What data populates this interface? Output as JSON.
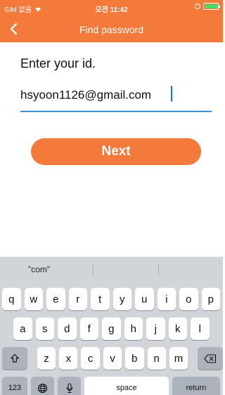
{
  "status_bar": {
    "carrier": "SIM 없음",
    "time": "오전 11:42"
  },
  "nav": {
    "title": "Find password",
    "back_icon": "chevron-left-icon"
  },
  "form": {
    "prompt": "Enter your id.",
    "id_value": "hsyoon1126@gmail.com",
    "next_label": "Next"
  },
  "keyboard": {
    "suggestions": [
      "\"com\"",
      "",
      ""
    ],
    "row1": [
      "q",
      "w",
      "e",
      "r",
      "t",
      "y",
      "u",
      "i",
      "o",
      "p"
    ],
    "row2": [
      "a",
      "s",
      "d",
      "f",
      "g",
      "h",
      "j",
      "k",
      "l"
    ],
    "row3": [
      "z",
      "x",
      "c",
      "v",
      "b",
      "n",
      "m"
    ],
    "numbers_label": "123",
    "space_label": "space",
    "return_label": "return"
  },
  "colors": {
    "accent": "#f47a3b",
    "underline": "#3b8ed8"
  }
}
